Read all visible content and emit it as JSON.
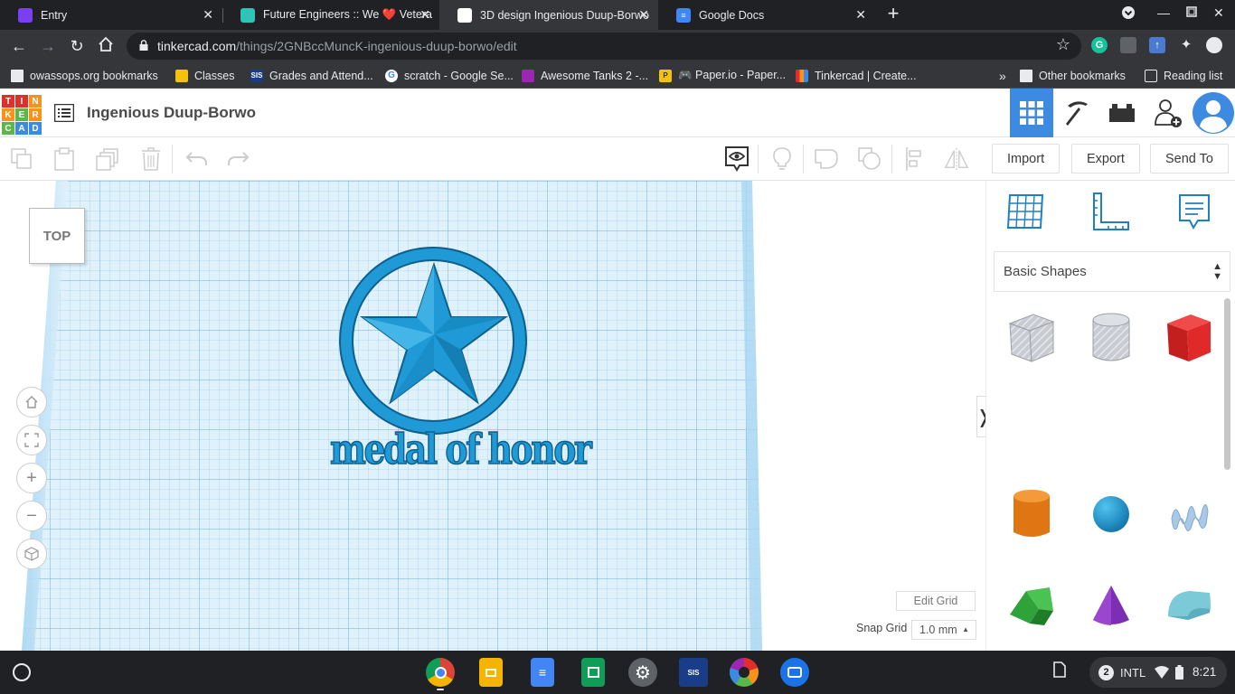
{
  "browser": {
    "tabs": [
      {
        "title": "Entry",
        "favicon_color": "#7b3ff2",
        "active": false
      },
      {
        "title": "Future Engineers :: We ❤️ Vetera",
        "favicon_color": "#2ec4b6",
        "active": false
      },
      {
        "title": "3D design Ingenious Duup-Borwo",
        "favicon_color": "#3d8be0",
        "active": true
      },
      {
        "title": "Google Docs",
        "favicon_color": "#4285f4",
        "active": false
      }
    ],
    "url_host": "tinkercad.com",
    "url_path": "/things/2GNBccMuncK-ingenious-duup-borwo/edit",
    "bookmarks": [
      {
        "label": "owassops.org bookmarks",
        "icon": "folder-icon"
      },
      {
        "label": "Classes",
        "icon": "classes-icon"
      },
      {
        "label": "Grades and Attend...",
        "icon": "sis-icon"
      },
      {
        "label": "scratch - Google Se...",
        "icon": "google-icon"
      },
      {
        "label": "Awesome Tanks 2 -...",
        "icon": "game-icon"
      },
      {
        "label": "🎮 Paper.io - Paper...",
        "icon": "paper-icon"
      },
      {
        "label": "Tinkercad | Create...",
        "icon": "tinkercad-icon"
      }
    ],
    "other_bookmarks": "Other bookmarks",
    "reading_list": "Reading list",
    "more_bookmarks": "»"
  },
  "app": {
    "logo_letters": [
      "T",
      "I",
      "N",
      "K",
      "E",
      "R",
      "C",
      "A",
      "D"
    ],
    "logo_colors": [
      "#e32d2d",
      "#e32d2d",
      "#f7921e",
      "#f7921e",
      "#5ab847",
      "#f7921e",
      "#5ab847",
      "#3d8be0",
      "#3d8be0"
    ],
    "design_title": "Ingenious Duup-Borwo",
    "toolbar": {
      "import_label": "Import",
      "export_label": "Export",
      "send_to_label": "Send To"
    },
    "viewcube_label": "TOP",
    "design_text": "medal of honor",
    "edit_grid_label": "Edit Grid",
    "snap_grid_label": "Snap Grid",
    "snap_grid_value": "1.0 mm",
    "shape_library": "Basic Shapes",
    "accent_color": "#3d8be0",
    "shape_color": "#1f9ad6"
  },
  "shelf": {
    "notification_count": "2",
    "input_method": "INTL",
    "time": "8:21"
  }
}
